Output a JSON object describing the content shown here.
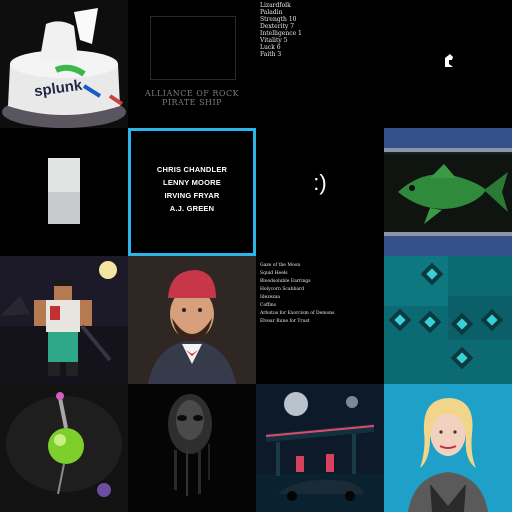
{
  "grid": {
    "selected_index": 5,
    "tiles": [
      {
        "name": "splunk-cake",
        "text": [
          "splunk"
        ]
      },
      {
        "name": "alliance-of-rock",
        "text": [
          "ALLIANCE OF ROCK",
          "PIRATE SHIP"
        ]
      },
      {
        "name": "character-stats",
        "text": [
          "Lizardfolk",
          "Paladin",
          "Strength 10",
          "Dexterity 7",
          "Intelligence 1",
          "Vitality 5",
          "Luck 6",
          "Faith 3"
        ]
      },
      {
        "name": "chess-knight",
        "text": []
      },
      {
        "name": "grey-swatch",
        "text": []
      },
      {
        "name": "player-names",
        "text": [
          "CHRIS CHANDLER",
          "LENNY MOORE",
          "IRVING FRYAR",
          "A.J. GREEN"
        ]
      },
      {
        "name": "smiley",
        "text": [
          ":)"
        ]
      },
      {
        "name": "goldfish",
        "text": []
      },
      {
        "name": "pixel-fighter",
        "text": []
      },
      {
        "name": "bearded-man",
        "text": []
      },
      {
        "name": "item-list",
        "text": [
          "Gaze of the Moon",
          "Squid Heels",
          "Bloodsoluble Earrings",
          "Holycorn Scabbard",
          "Idezezaa",
          "Coffins",
          "Arbutus for Exorcism of Demons",
          "Elvear Rune for Trust"
        ]
      },
      {
        "name": "teal-squares",
        "text": []
      },
      {
        "name": "potion-bottle",
        "text": []
      },
      {
        "name": "shadow-face",
        "text": []
      },
      {
        "name": "gas-station",
        "text": []
      },
      {
        "name": "blonde-woman",
        "text": []
      }
    ]
  },
  "colors": {
    "selection": "#2ab6e8",
    "background": "#000000"
  }
}
